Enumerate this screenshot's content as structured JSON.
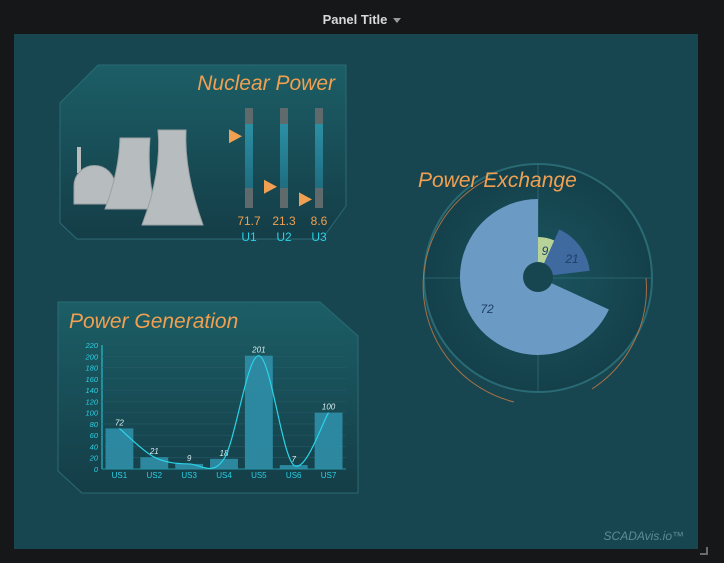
{
  "panel": {
    "title": "Panel Title"
  },
  "nuclear": {
    "title": "Nuclear Power",
    "units": [
      {
        "label": "U1",
        "value_text": "71.7",
        "value": 71.7
      },
      {
        "label": "U2",
        "value_text": "21.3",
        "value": 21.3
      },
      {
        "label": "U3",
        "value_text": "8.6",
        "value": 8.6
      }
    ]
  },
  "exchange": {
    "title": "Power Exchange",
    "slices": [
      {
        "label": "9",
        "value": 9,
        "color": "#b7d39a"
      },
      {
        "label": "21",
        "value": 21,
        "color": "#3f6aa0"
      },
      {
        "label": "72",
        "value": 72,
        "color": "#6b9ac4"
      }
    ]
  },
  "generation": {
    "title": "Power Generation"
  },
  "chart_data": {
    "type": "bar",
    "categories": [
      "US1",
      "US2",
      "US3",
      "US4",
      "US5",
      "US6",
      "US7"
    ],
    "values": [
      72,
      21,
      9,
      18,
      201,
      7,
      100
    ],
    "ylim": [
      0,
      220
    ],
    "yticks": [
      0,
      20,
      40,
      60,
      80,
      100,
      120,
      140,
      160,
      180,
      200,
      220
    ],
    "bar_color": "#2f8fa8",
    "line_color": "#29d4e8"
  },
  "colors": {
    "accent": "#f0a050",
    "cyan": "#2ad0e4",
    "panel_bg": "#184650"
  },
  "footer": {
    "watermark": "SCADAvis.io™"
  }
}
